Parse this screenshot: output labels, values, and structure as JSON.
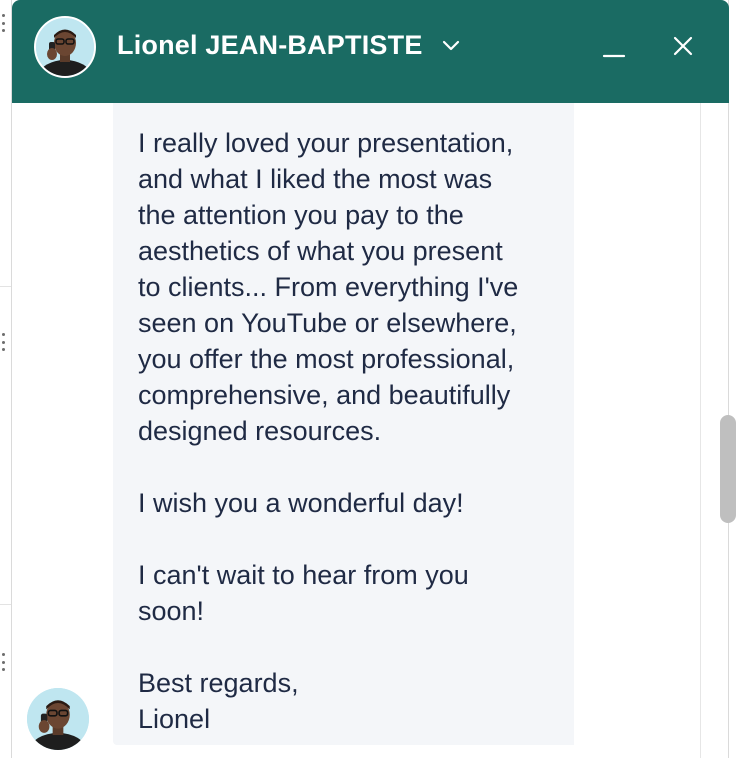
{
  "header": {
    "contact_name": "Lionel JEAN-BAPTISTE",
    "avatar_icon": "avatar-icon",
    "chevron_icon": "chevron-down-icon",
    "minimize_icon": "minimize-icon",
    "close_icon": "close-icon",
    "background_color": "#1a6b63"
  },
  "message": {
    "text": "I really loved your presentation,\nand what I liked the most was\nthe attention you pay to the\naesthetics of what you present\nto clients... From everything I've\nseen on YouTube or elsewhere,\nyou offer the most professional,\ncomprehensive, and beautifully\ndesigned resources.\n\nI wish you a wonderful day!\n\nI can't wait to hear from you\nsoon!\n\nBest regards,\nLionel",
    "bubble_color": "#f4f6f9",
    "text_color": "#1f2a44"
  }
}
